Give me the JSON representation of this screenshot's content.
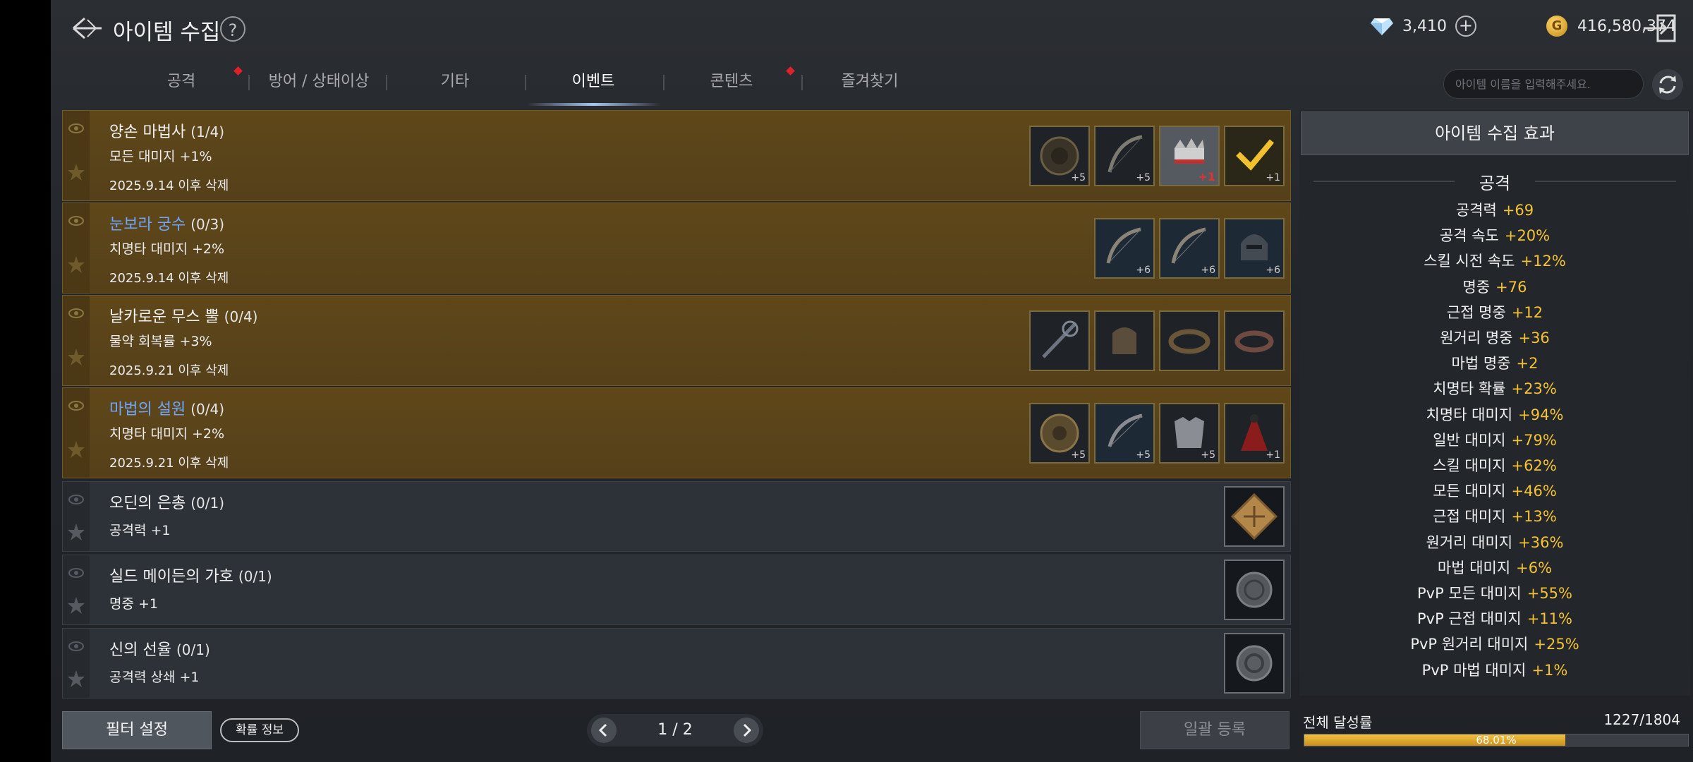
{
  "header": {
    "title": "아이템 수집",
    "help": "?",
    "diamonds": "3,410",
    "gold_symbol": "G",
    "gold": "416,580,374"
  },
  "tabs": [
    {
      "label": "공격",
      "active": false,
      "new": true
    },
    {
      "label": "방어 / 상태이상",
      "active": false,
      "new": false
    },
    {
      "label": "기타",
      "active": false,
      "new": false
    },
    {
      "label": "이벤트",
      "active": true,
      "new": false
    },
    {
      "label": "콘텐츠",
      "active": false,
      "new": true
    },
    {
      "label": "즐겨찾기",
      "active": false,
      "new": false
    }
  ],
  "search": {
    "placeholder": "아이템 이름을 입력해주세요."
  },
  "collections": [
    {
      "name": "양손 마법사",
      "count": "(1/4)",
      "effect": "모든 대미지 +1%",
      "date": "2025.9.14 이후 삭제",
      "type": "event",
      "name_color": "white",
      "items": [
        {
          "icon": "orb-icon",
          "enh": "+5"
        },
        {
          "icon": "bow-icon",
          "enh": "+5"
        },
        {
          "icon": "crown-icon",
          "enh": "+1",
          "red": true
        },
        {
          "icon": "check-icon",
          "enh": "+1"
        }
      ]
    },
    {
      "name": "눈보라 궁수",
      "count": "(0/3)",
      "effect": "치명타 대미지 +2%",
      "date": "2025.9.14 이후 삭제",
      "type": "event",
      "name_color": "blue",
      "items": [
        {
          "icon": "bow-icon",
          "enh": "+6"
        },
        {
          "icon": "bow-icon",
          "enh": "+6"
        },
        {
          "icon": "helmet-icon",
          "enh": "+6"
        }
      ]
    },
    {
      "name": "날카로운 무스 뿔",
      "count": "(0/4)",
      "effect": "물약 회복률 +3%",
      "date": "2025.9.21 이후 삭제",
      "type": "event",
      "name_color": "white",
      "items": [
        {
          "icon": "staff-icon",
          "enh": ""
        },
        {
          "icon": "glove-icon",
          "enh": ""
        },
        {
          "icon": "belt-icon",
          "enh": ""
        },
        {
          "icon": "belt-icon",
          "enh": ""
        }
      ]
    },
    {
      "name": "마법의 설원",
      "count": "(0/4)",
      "effect": "치명타 대미지 +2%",
      "date": "2025.9.21 이후 삭제",
      "type": "event",
      "name_color": "blue",
      "items": [
        {
          "icon": "orb-icon",
          "enh": "+5"
        },
        {
          "icon": "bow-icon",
          "enh": "+5"
        },
        {
          "icon": "armor-icon",
          "enh": "+5"
        },
        {
          "icon": "cloak-icon",
          "enh": "+1"
        }
      ]
    },
    {
      "name": "오딘의 은총",
      "count": "(0/1)",
      "effect": "공격력 +1",
      "date": "",
      "type": "normal",
      "name_color": "white",
      "items": [
        {
          "icon": "rune-icon",
          "enh": ""
        }
      ]
    },
    {
      "name": "실드 메이든의 가호",
      "count": "(0/1)",
      "effect": "명중 +1",
      "date": "",
      "type": "normal",
      "name_color": "white",
      "items": [
        {
          "icon": "coin-icon",
          "enh": ""
        }
      ]
    },
    {
      "name": "신의 선율",
      "count": "(0/1)",
      "effect": "공격력 상쇄 +1",
      "date": "",
      "type": "normal",
      "name_color": "white",
      "items": [
        {
          "icon": "coin-icon",
          "enh": ""
        }
      ]
    }
  ],
  "panel": {
    "title": "아이템 수집 효과",
    "section": "공격",
    "stats": [
      {
        "label": "공격력",
        "value": "+69"
      },
      {
        "label": "공격 속도",
        "value": "+20%"
      },
      {
        "label": "스킬 시전 속도",
        "value": "+12%"
      },
      {
        "label": "명중",
        "value": "+76"
      },
      {
        "label": "근접 명중",
        "value": "+12"
      },
      {
        "label": "원거리 명중",
        "value": "+36"
      },
      {
        "label": "마법 명중",
        "value": "+2"
      },
      {
        "label": "치명타 확률",
        "value": "+23%"
      },
      {
        "label": "치명타 대미지",
        "value": "+94%"
      },
      {
        "label": "일반 대미지",
        "value": "+79%"
      },
      {
        "label": "스킬 대미지",
        "value": "+62%"
      },
      {
        "label": "모든 대미지",
        "value": "+46%"
      },
      {
        "label": "근접 대미지",
        "value": "+13%"
      },
      {
        "label": "원거리 대미지",
        "value": "+36%"
      },
      {
        "label": "마법 대미지",
        "value": "+6%"
      },
      {
        "label": "PvP 모든 대미지",
        "value": "+55%"
      },
      {
        "label": "PvP 근접 대미지",
        "value": "+11%"
      },
      {
        "label": "PvP 원거리 대미지",
        "value": "+25%"
      },
      {
        "label": "PvP 마법 대미지",
        "value": "+1%"
      }
    ]
  },
  "footer": {
    "filter": "필터 설정",
    "probability": "확률 정보",
    "page": "1 / 2",
    "bulk": "일괄 등록",
    "achievement_label": "전체 달성률",
    "achievement_count": "1227/1804",
    "achievement_pct": "68.01%",
    "achievement_fraction": 0.6801
  },
  "colors": {
    "event_bg": "#5f4719",
    "accent_blue": "#6ea5ff",
    "value_gold": "#f4c232"
  }
}
